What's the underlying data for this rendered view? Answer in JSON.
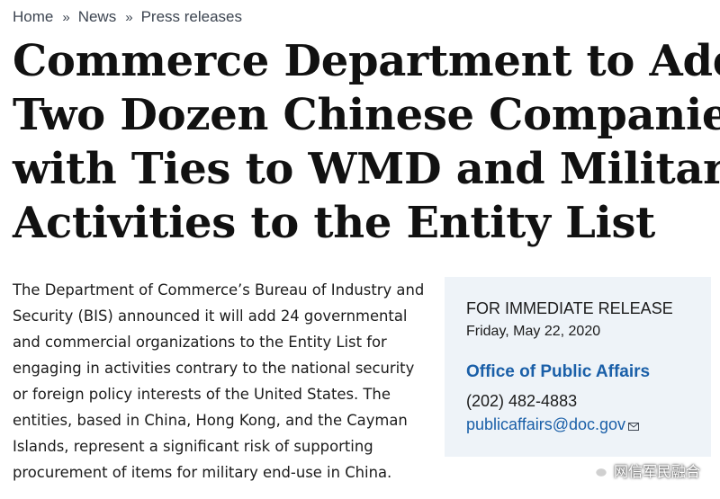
{
  "breadcrumb": {
    "items": [
      "Home",
      "News",
      "Press releases"
    ],
    "separator": "»"
  },
  "article": {
    "title_lines": [
      "Commerce Department to Add",
      "Two Dozen Chinese Companies",
      "with Ties to WMD and Military",
      "Activities to the Entity List"
    ],
    "body_lines": [
      "The Department of Commerce’s Bureau of Industry and",
      "Security (BIS) announced it will add 24 governmental",
      "and commercial organizations to the Entity List for",
      "engaging in activities contrary to the national security",
      "or foreign policy interests of the United States. The",
      "entities, based in China, Hong Kong, and the Cayman",
      "Islands, represent a significant risk of supporting",
      "procurement of items for military end-use in China."
    ]
  },
  "release_box": {
    "label": "FOR IMMEDIATE RELEASE",
    "date": "Friday, May 22, 2020",
    "office": "Office of Public Affairs",
    "phone": "(202) 482-4883",
    "email": "publicaffairs@doc.gov",
    "email_icon": "mail-icon"
  },
  "watermark": {
    "text": "网信军民融合",
    "icon": "wechat-icon"
  },
  "colors": {
    "link": "#1a5fa8",
    "box_background": "#eef3f8",
    "text": "#1b1b1b"
  }
}
